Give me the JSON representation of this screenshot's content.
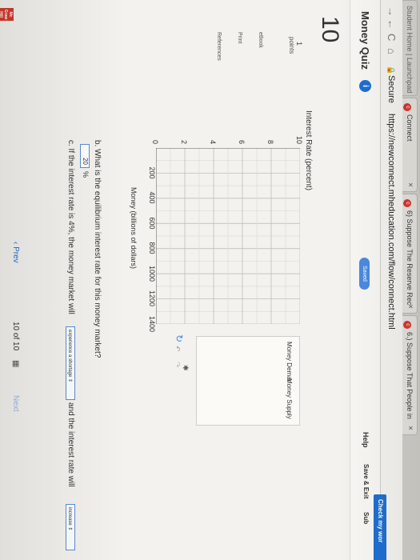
{
  "browser": {
    "tabs": [
      {
        "label": "Student Home  |  Launchpad",
        "icon": "page-icon"
      },
      {
        "label": "Connect",
        "icon": "connect-icon"
      },
      {
        "label": "6) Suppose The Reserve Rec",
        "icon": "chegg-icon"
      },
      {
        "label": "6.) Suppose That People in",
        "icon": "chegg-icon"
      }
    ],
    "secure_label": "Secure",
    "url": "https://newconnect.mheducation.com/flow/connect.html"
  },
  "header": {
    "title": "Money Quiz",
    "saved": "Saved",
    "help": "Help",
    "save_exit": "Save & Exit",
    "submit": "Sub",
    "check_work": "Check my wor"
  },
  "question": {
    "number": "10",
    "points_value": "1",
    "points_label": "points"
  },
  "rail": {
    "ebook": "eBook",
    "print": "Print",
    "references": "References"
  },
  "graph": {
    "y_label": "Interest Rate (percent)",
    "x_label": "Money (billions of dollars)",
    "legend_demand": "Money Demar",
    "legend_supply": "Money Supply"
  },
  "chart_data": {
    "type": "line",
    "title": "",
    "xlabel": "Money (billions of dollars)",
    "ylabel": "Interest Rate (percent)",
    "x_ticks": [
      200,
      400,
      600,
      800,
      1000,
      1200,
      1400
    ],
    "y_ticks": [
      0,
      2,
      4,
      6,
      8,
      10
    ],
    "xlim": [
      0,
      1400
    ],
    "ylim": [
      0,
      10
    ],
    "grid": true,
    "series": []
  },
  "questions": {
    "b_text": "b. What is the equilibrium interest rate for this money market?",
    "b_answer": "20",
    "b_unit": "%",
    "c_text_pre": "c. If the interest rate is 4%, the money market will",
    "c_dropdown1": "experience a shortage",
    "c_text_mid": "and the interest rate will",
    "c_dropdown2": "increase"
  },
  "pager": {
    "prev": "Prev",
    "current": "10",
    "of": "of",
    "total": "10",
    "next": "Next"
  },
  "colors": {
    "accent": "#1f6fd1",
    "brand_red": "#d23a2c"
  }
}
